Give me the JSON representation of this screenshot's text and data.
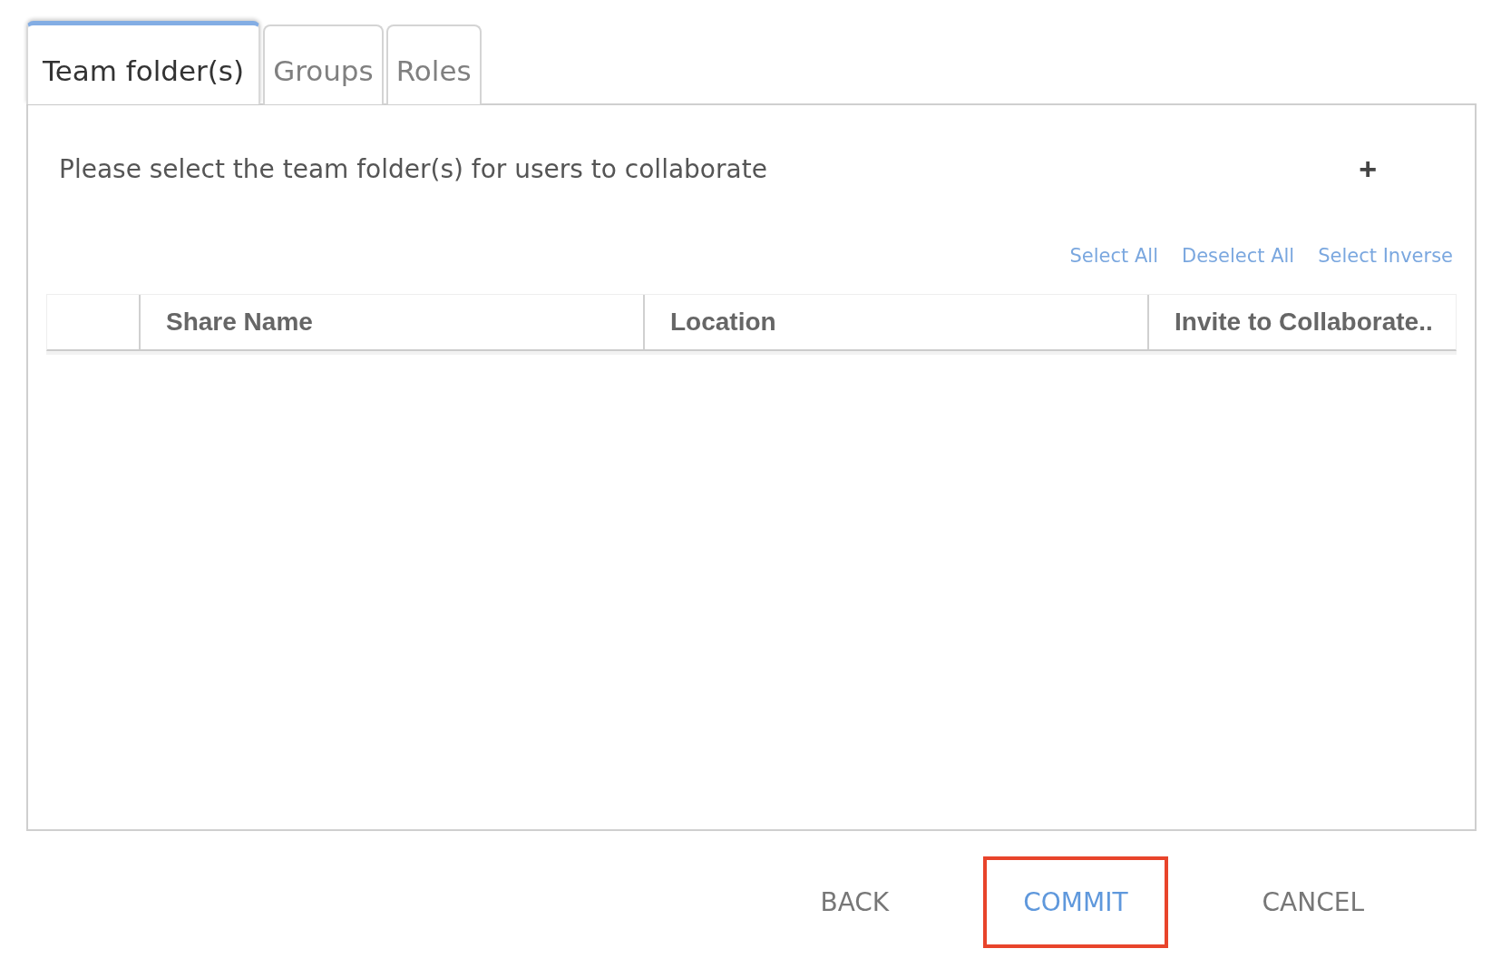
{
  "tabs": [
    {
      "label": "Team folder(s)",
      "selected": true
    },
    {
      "label": "Groups",
      "selected": false
    },
    {
      "label": "Roles",
      "selected": false
    }
  ],
  "panel": {
    "description": "Please select the team folder(s) for users to collaborate",
    "add_icon": "+",
    "links": [
      "Select All",
      "Deselect All",
      "Select Inverse"
    ],
    "table": {
      "columns": [
        {
          "label": "Share Name"
        },
        {
          "label": "Location"
        },
        {
          "label": "Invite to Collaborate.."
        }
      ]
    }
  },
  "buttons": [
    {
      "label": "BACK",
      "primary": false,
      "highlighted": false
    },
    {
      "label": "COMMIT",
      "primary": true,
      "highlighted": true
    },
    {
      "label": "CANCEL",
      "primary": false,
      "highlighted": false
    }
  ]
}
